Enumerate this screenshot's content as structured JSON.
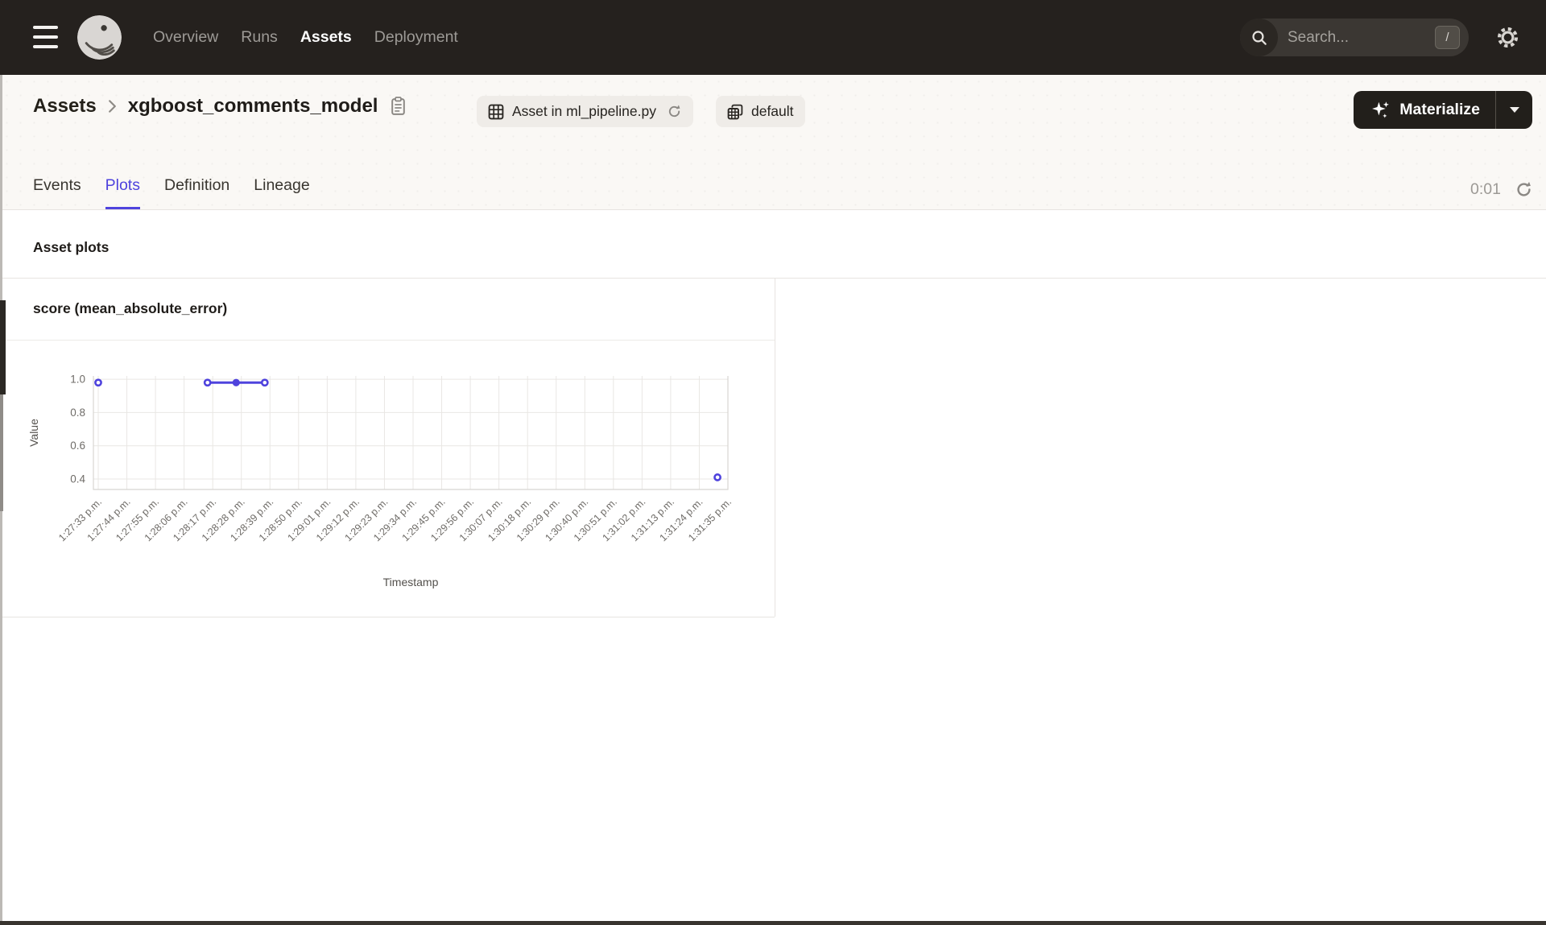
{
  "navbar": {
    "links": [
      {
        "label": "Overview",
        "active": false
      },
      {
        "label": "Runs",
        "active": false
      },
      {
        "label": "Assets",
        "active": true
      },
      {
        "label": "Deployment",
        "active": false
      }
    ],
    "search": {
      "placeholder": "Search...",
      "shortcut": "/"
    }
  },
  "header": {
    "breadcrumb": {
      "root": "Assets",
      "current": "xgboost_comments_model"
    },
    "badges": [
      {
        "icon": "table-grid-icon",
        "label": "Asset in ml_pipeline.py",
        "has_refresh": true
      },
      {
        "icon": "layers-grid-icon",
        "label": "default",
        "has_refresh": false
      }
    ],
    "materialize": {
      "label": "Materialize"
    }
  },
  "tabs": {
    "items": [
      {
        "label": "Events",
        "active": false
      },
      {
        "label": "Plots",
        "active": true
      },
      {
        "label": "Definition",
        "active": false
      },
      {
        "label": "Lineage",
        "active": false
      }
    ],
    "timer": "0:01"
  },
  "content": {
    "section_title": "Asset plots"
  },
  "chart_data": {
    "type": "line",
    "title": "score (mean_absolute_error)",
    "xlabel": "Timestamp",
    "ylabel": "Value",
    "x_tick_labels": [
      "1:27:33 p.m.",
      "1:27:44 p.m.",
      "1:27:55 p.m.",
      "1:28:06 p.m.",
      "1:28:17 p.m.",
      "1:28:28 p.m.",
      "1:28:39 p.m.",
      "1:28:50 p.m.",
      "1:29:01 p.m.",
      "1:29:12 p.m.",
      "1:29:23 p.m.",
      "1:29:34 p.m.",
      "1:29:45 p.m.",
      "1:29:56 p.m.",
      "1:30:07 p.m.",
      "1:30:18 p.m.",
      "1:30:29 p.m.",
      "1:30:40 p.m.",
      "1:30:51 p.m.",
      "1:31:02 p.m.",
      "1:31:13 p.m.",
      "1:31:24 p.m.",
      "1:31:35 p.m."
    ],
    "x_range_seconds": [
      0,
      242
    ],
    "y_ticks": [
      0.4,
      0.6,
      0.8,
      1.0
    ],
    "y_range": [
      0.337,
      1.02
    ],
    "grid": true,
    "legend": "none",
    "points": [
      {
        "time": "1:27:33 p.m.",
        "seconds": 0,
        "value": 0.98,
        "marker": "hollow"
      },
      {
        "time": "1:28:15 p.m.",
        "seconds": 42,
        "value": 0.98,
        "marker": "hollow"
      },
      {
        "time": "1:28:26 p.m.",
        "seconds": 53,
        "value": 0.98,
        "marker": "filled"
      },
      {
        "time": "1:28:37 p.m.",
        "seconds": 64,
        "value": 0.98,
        "marker": "hollow"
      },
      {
        "time": "1:31:31 p.m.",
        "seconds": 238,
        "value": 0.41,
        "marker": "hollow"
      }
    ],
    "line_segments": [
      [
        1,
        2,
        3
      ]
    ],
    "line_color": "#4f43dd"
  },
  "colors": {
    "accent": "#4f43dd",
    "navbar_bg": "#25211e",
    "page_bg": "#faf8f5",
    "content_bg": "#ffffff",
    "border": "#e7e4e1"
  }
}
